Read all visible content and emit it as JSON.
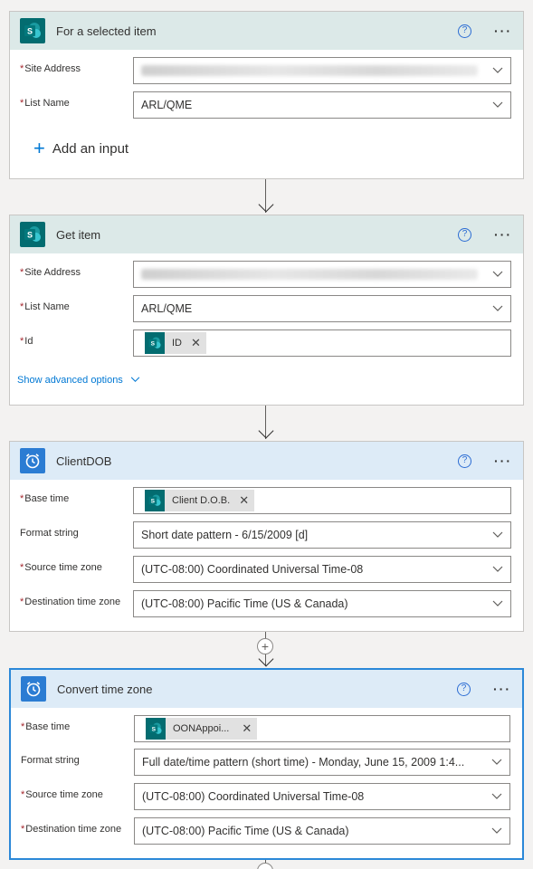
{
  "cards": [
    {
      "title": "For a selected item",
      "help": "?",
      "more": "···",
      "fields": {
        "site_label": "Site Address",
        "site_value": "",
        "list_label": "List Name",
        "list_value": "ARL/QME"
      },
      "add_input": "Add an input"
    },
    {
      "title": "Get item",
      "help": "?",
      "more": "···",
      "fields": {
        "site_label": "Site Address",
        "site_value": "",
        "list_label": "List Name",
        "list_value": "ARL/QME",
        "id_label": "Id",
        "id_token": "ID"
      },
      "advanced": "Show advanced options"
    },
    {
      "title": "ClientDOB",
      "help": "?",
      "more": "···",
      "fields": {
        "base_label": "Base time",
        "base_token": "Client D.O.B.",
        "format_label": "Format string",
        "format_value": "Short date pattern - 6/15/2009 [d]",
        "src_label": "Source time zone",
        "src_value": "(UTC-08:00) Coordinated Universal Time-08",
        "dst_label": "Destination time zone",
        "dst_value": "(UTC-08:00) Pacific Time (US & Canada)"
      }
    },
    {
      "title": "Convert time zone",
      "help": "?",
      "more": "···",
      "fields": {
        "base_label": "Base time",
        "base_token": "OONAppoi...",
        "format_label": "Format string",
        "format_value": "Full date/time pattern (short time) - Monday, June 15, 2009 1:4...",
        "src_label": "Source time zone",
        "src_value": "(UTC-08:00) Coordinated Universal Time-08",
        "dst_label": "Destination time zone",
        "dst_value": "(UTC-08:00) Pacific Time (US & Canada)"
      }
    }
  ],
  "colors": {
    "sharepoint": "#036c70",
    "time": "#2b7cd3",
    "accent": "#0078d4",
    "required": "#a4262c"
  },
  "icons": {
    "sharepoint": "sharepoint-icon",
    "alarm": "alarm-clock-icon",
    "help": "help-circle-icon",
    "more": "more-icon",
    "chevron": "chevron-down-icon",
    "close": "close-icon",
    "plus": "plus-icon"
  },
  "required_marker": "*",
  "token_remove": "✕",
  "add_step": "+"
}
